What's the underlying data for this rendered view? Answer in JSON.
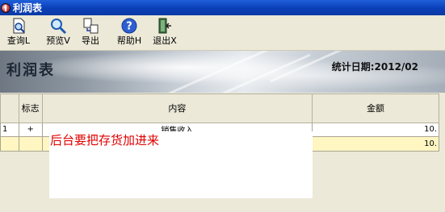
{
  "window": {
    "title": "利润表"
  },
  "toolbar": {
    "query_label": "查询L",
    "preview_label": "预览V",
    "export_label": "导出",
    "help_label": "帮助H",
    "exit_label": "退出X"
  },
  "banner": {
    "title": "利润表",
    "stat_period": "统计日期:2012/02"
  },
  "table": {
    "headers": {
      "flag": "标志",
      "content": "内容",
      "amount": "金额"
    },
    "rows": [
      {
        "index": "1",
        "flag": "+",
        "content": "销售收入",
        "amount": "10."
      },
      {
        "index": "",
        "flag": "",
        "content": "",
        "amount": "10."
      }
    ]
  },
  "overlay": {
    "note": "后台要把存货加进来"
  },
  "colors": {
    "titlebar": "#0a3fb8",
    "note_text": "#e00000",
    "selected_row": "#fff6c2"
  }
}
